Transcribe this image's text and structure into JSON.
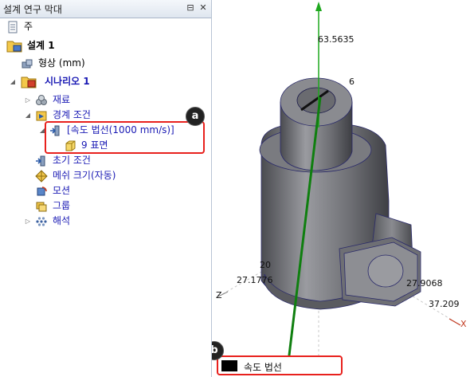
{
  "panel": {
    "title": "설계 연구 막대",
    "pin_glyph": "⊟",
    "close_glyph": "✕"
  },
  "tree": {
    "root_label": "주",
    "design_label": "설계 1",
    "geometry_label": "형상 (mm)",
    "scenario_label": "시나리오 1",
    "materials_label": "재료",
    "boundary_label": "경계 조건",
    "velocity_item_label": "[속도 법선(1000 mm/s)]",
    "faces_label": "9 표면",
    "initial_label": "초기 조건",
    "mesh_label": "메쉬 크기(자동)",
    "motion_label": "모션",
    "groups_label": "그룹",
    "analysis_label": "해석"
  },
  "callouts": {
    "a": "a",
    "b": "b"
  },
  "viewport": {
    "tag_label": "속도 법선",
    "dims": {
      "top": "63.5635",
      "left": "27.1776",
      "left_partial": "20",
      "right": "27.9068",
      "right_axis": "37.209",
      "part": "6"
    },
    "axis_z": "Z",
    "axis_x": "X",
    "colors": {
      "body": "#6e6f74",
      "arrow": "#0f7f0f",
      "highlight": "#e8211d"
    }
  }
}
